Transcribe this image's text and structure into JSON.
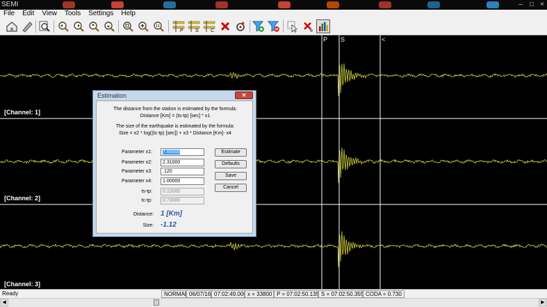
{
  "window": {
    "app_label": "SEMI"
  },
  "menu": {
    "items": [
      "File",
      "Edit",
      "View",
      "Tools",
      "Settings",
      "Help"
    ]
  },
  "toolbar": {
    "buttons": [
      "home-icon",
      "pencil-icon",
      "info-search-icon",
      "zoom-in-icon",
      "zoom-out-icon",
      "zoom-vertical-icon",
      "zoom-fit-icon",
      "zoom-select-icon",
      "zoom-plus-icon",
      "zoom-reset-icon",
      "pick-p-icon",
      "pick-s-icon",
      "pick-coda-icon",
      "delete-red-icon",
      "refresh-icon",
      "filter-add-icon",
      "filter-remove-icon",
      "cursor-icon",
      "close-red-icon",
      "bar-chart-icon"
    ],
    "pick_letters": {
      "p": "P",
      "s": "S",
      "c": "C"
    }
  },
  "chart": {
    "channels": [
      "[Channel: 1]",
      "[Channel: 2]",
      "[Channel: 3]"
    ],
    "markers": {
      "p": "P",
      "s": "S",
      "coda": "<"
    },
    "trace_color": "#d8d840"
  },
  "dialog": {
    "title": "Estimation",
    "text_distance_1": "The distance from the station is estimated by the formula:",
    "text_distance_2": "Distance [Km] = (ts-tp) [sec] * x1",
    "text_size_1": "The size of the earthquake is estimated by the formula:",
    "text_size_2": "Size = x2 * log((tc-tp) [sec]) + x3 * Distance [Km]- x4",
    "params": [
      {
        "label": "Parameter x1:",
        "value": "7.60000",
        "selected": true,
        "disabled": false
      },
      {
        "label": "Parameter x2:",
        "value": "2.31000",
        "selected": false,
        "disabled": false
      },
      {
        "label": "Parameter x3:",
        "value": ".120",
        "selected": false,
        "disabled": false
      },
      {
        "label": "Parameter x4:",
        "value": "1.00000",
        "selected": false,
        "disabled": false
      },
      {
        "label": "ts-tp:",
        "value": "0.22000",
        "selected": false,
        "disabled": true
      },
      {
        "label": "tc-tp:",
        "value": "0.73000",
        "selected": false,
        "disabled": true
      }
    ],
    "buttons": {
      "estimate": "Estimate",
      "defaults": "Defaults",
      "save": "Save",
      "cancel": "Cancel"
    },
    "results": {
      "distance_label": "Distance:",
      "distance_value": "1 [Km]",
      "size_label": "Size:",
      "size_value": "-1.12"
    }
  },
  "status": {
    "ready": "Ready",
    "mode": "NORMAL",
    "date": "06/07/16",
    "time": "07:02:49.000",
    "x": "x = 33800",
    "p": "P = 07:02:50.135",
    "s": "S = 07:02:50.355",
    "coda": "CODA = 0.730"
  }
}
